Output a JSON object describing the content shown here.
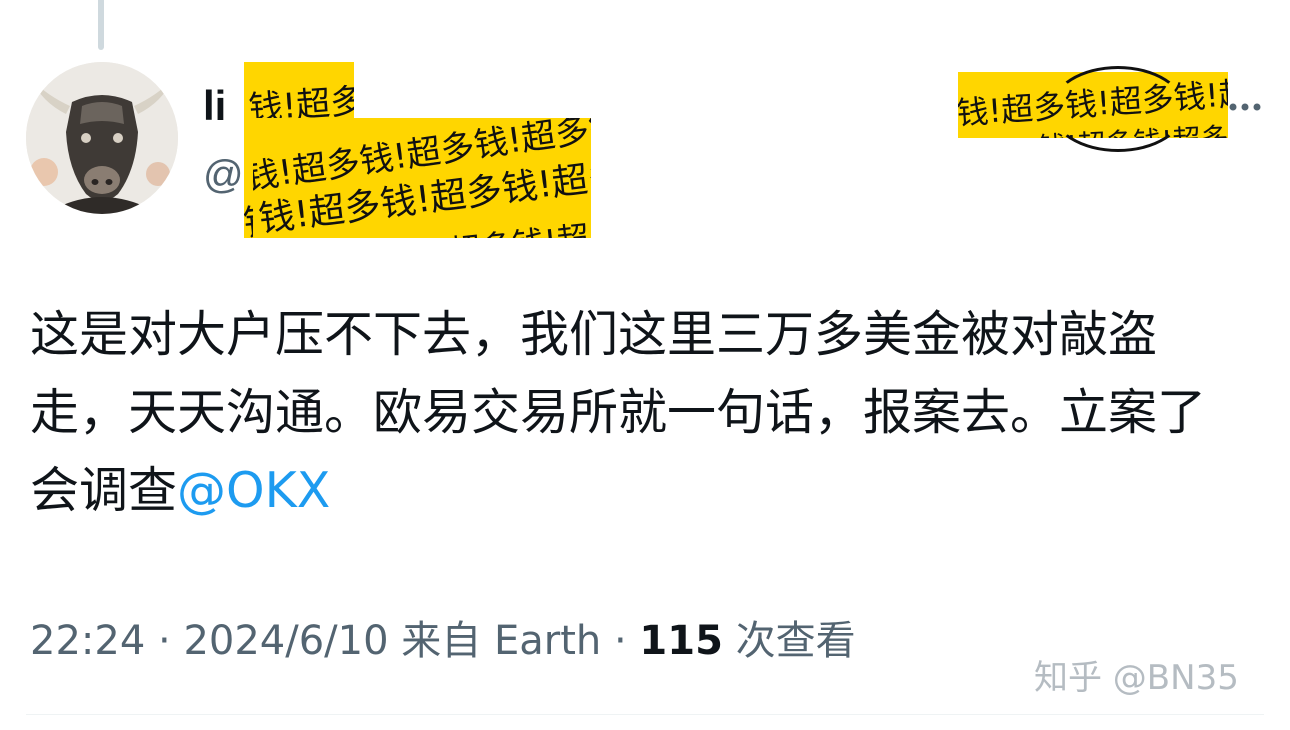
{
  "post": {
    "author_name_visible": "li",
    "author_handle_visible": "@l",
    "redaction_text": "钱!超多钱!超多钱!超多钱",
    "text_before_mention": "这是对大户压不下去，我们这里三万多美金被对敲盗走，天天沟通。欧易交易所就一句话，报案去。立案了会调查",
    "mention": "@OKX",
    "time": "22:24",
    "separator": "·",
    "date": "2024/6/10",
    "source": "来自 Earth",
    "views_count": "115",
    "views_label": "次查看"
  },
  "watermark": "知乎 @BN35",
  "icons": {
    "more": "more-horizontal-icon",
    "avatar": "bull-avatar-image"
  },
  "colors": {
    "redaction": "#ffd600",
    "mention": "#1d9bf0",
    "secondary_text": "#536471"
  }
}
